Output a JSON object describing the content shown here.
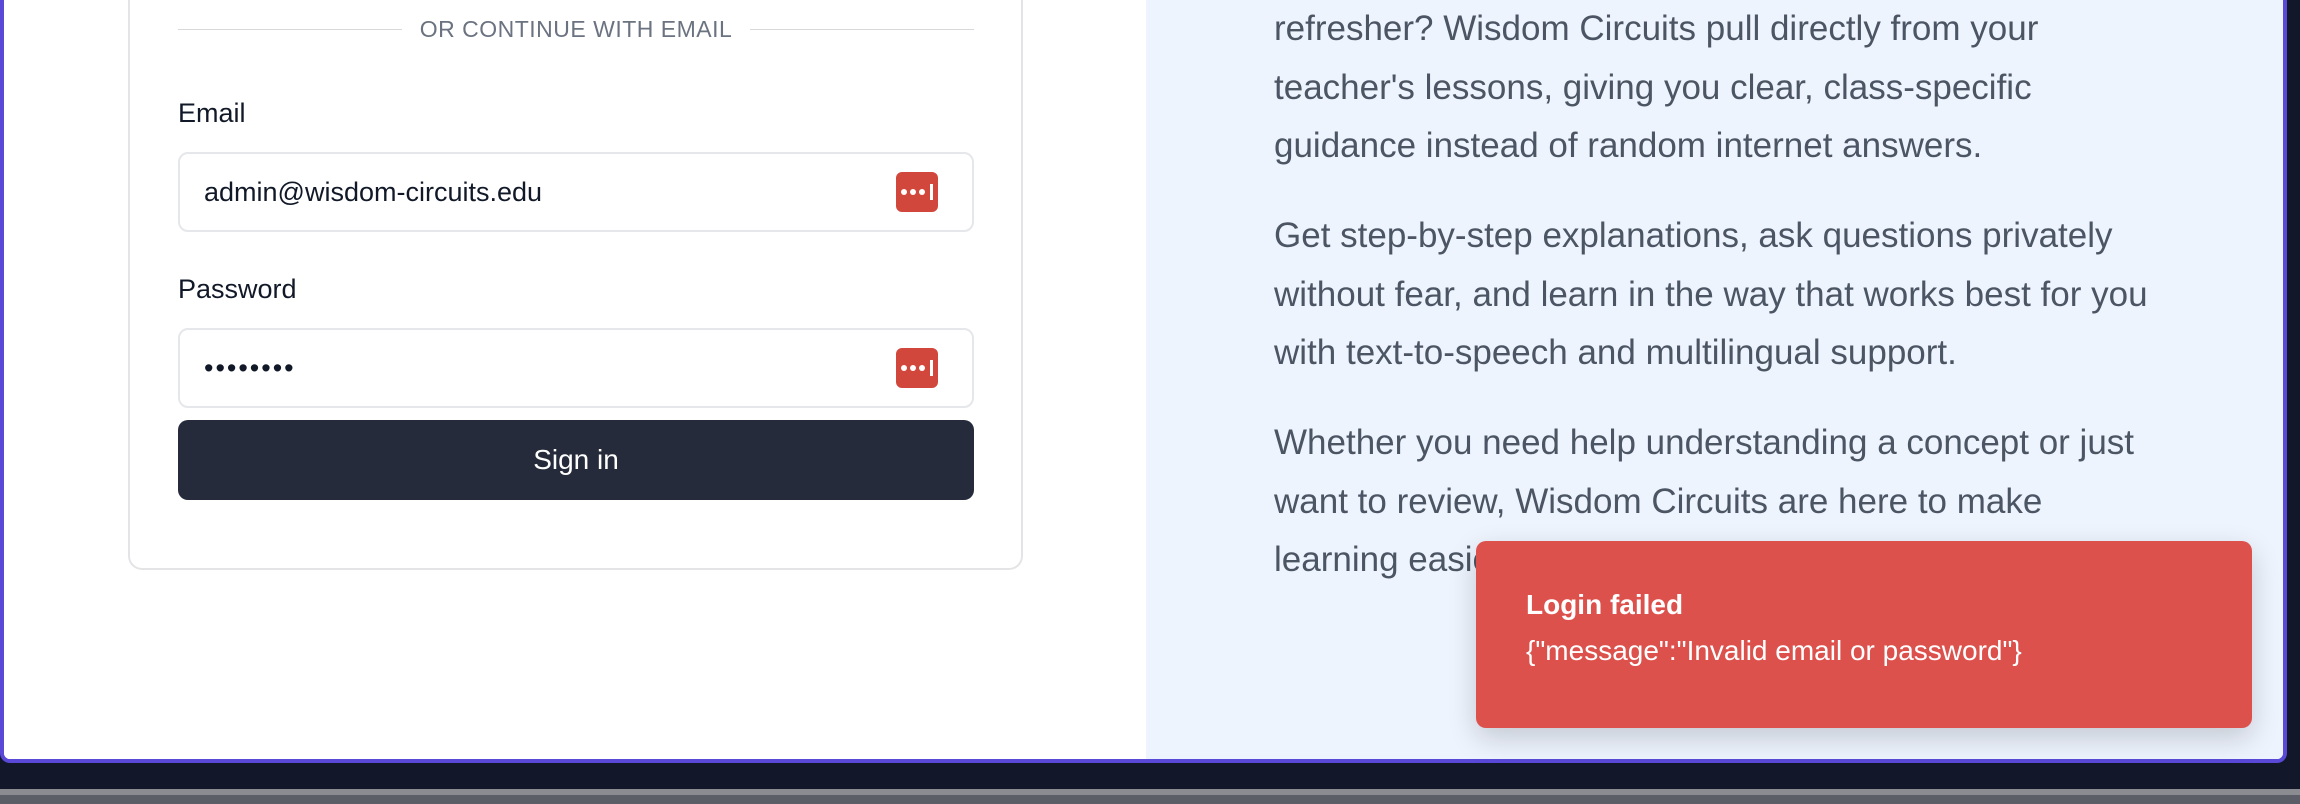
{
  "login": {
    "divider": "OR CONTINUE WITH EMAIL",
    "email_label": "Email",
    "email_value": "admin@wisdom-circuits.edu",
    "password_label": "Password",
    "password_value": "••••••••",
    "signin_label": "Sign in"
  },
  "promo": {
    "paragraphs": [
      "refresher? Wisdom Circuits pull directly from your teacher's lessons, giving you clear, class-specific guidance instead of random internet answers.",
      "Get step-by-step explanations, ask questions privately without fear, and learn in the way that works best for you with text-to-speech and multilingual support.",
      "Whether you need help understanding a concept or just want to review, Wisdom Circuits are here to make learning easier, anytime, anywhere."
    ]
  },
  "toast": {
    "title": "Login failed",
    "message": "{\"message\":\"Invalid email or password\"}"
  },
  "colors": {
    "accent_border": "#5a49d6",
    "toast_bg": "#dd514d",
    "button_bg": "#262b3c",
    "password_manager_icon": "#d2473c"
  },
  "icons": [
    "password-manager-icon"
  ]
}
